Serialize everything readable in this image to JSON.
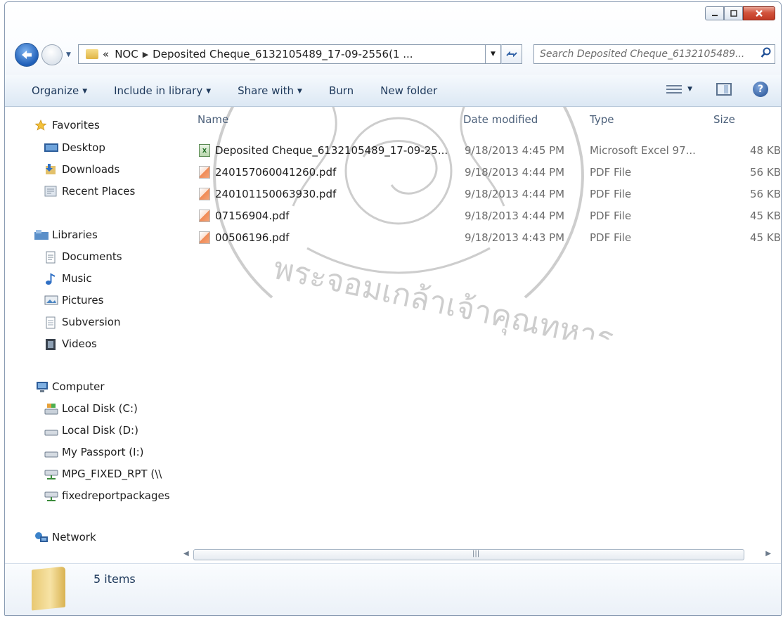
{
  "window": {
    "buttons": [
      "minimize",
      "maximize",
      "close"
    ]
  },
  "nav": {
    "breadcrumb_overflow": "«",
    "breadcrumb": [
      "NOC",
      "Deposited Cheque_6132105489_17-09-2556(1 ..."
    ],
    "search_placeholder": "Search Deposited Cheque_6132105489..."
  },
  "toolbar": {
    "organize": "Organize",
    "include_in_library": "Include in library",
    "share_with": "Share with",
    "burn": "Burn",
    "new_folder": "New folder"
  },
  "sidebar": {
    "favorites": {
      "label": "Favorites",
      "items": [
        "Desktop",
        "Downloads",
        "Recent Places"
      ]
    },
    "libraries": {
      "label": "Libraries",
      "items": [
        "Documents",
        "Music",
        "Pictures",
        "Subversion",
        "Videos"
      ]
    },
    "computer": {
      "label": "Computer",
      "items": [
        "Local Disk (C:)",
        "Local Disk (D:)",
        "My Passport (I:)",
        "MPG_FIXED_RPT (\\\\",
        "fixedreportpackages"
      ]
    },
    "network": {
      "label": "Network"
    }
  },
  "columns": {
    "name": "Name",
    "date": "Date modified",
    "type": "Type",
    "size": "Size"
  },
  "files": [
    {
      "name": "Deposited Cheque_6132105489_17-09-25...",
      "date": "9/18/2013 4:45 PM",
      "type": "Microsoft Excel 97...",
      "size": "48 KB",
      "icon": "excel-icon"
    },
    {
      "name": "240157060041260.pdf",
      "date": "9/18/2013 4:44 PM",
      "type": "PDF File",
      "size": "56 KB",
      "icon": "pdf-icon"
    },
    {
      "name": "240101150063930.pdf",
      "date": "9/18/2013 4:44 PM",
      "type": "PDF File",
      "size": "56 KB",
      "icon": "pdf-icon"
    },
    {
      "name": "07156904.pdf",
      "date": "9/18/2013 4:44 PM",
      "type": "PDF File",
      "size": "45 KB",
      "icon": "pdf-icon"
    },
    {
      "name": "00506196.pdf",
      "date": "9/18/2013 4:43 PM",
      "type": "PDF File",
      "size": "45 KB",
      "icon": "pdf-icon"
    }
  ],
  "details": {
    "count": "5 items"
  },
  "watermark_text": "พระจอมเกล้าเจ้าคุณทหาร",
  "colors": {
    "accent": "#1e395b",
    "close": "#c13a24"
  }
}
